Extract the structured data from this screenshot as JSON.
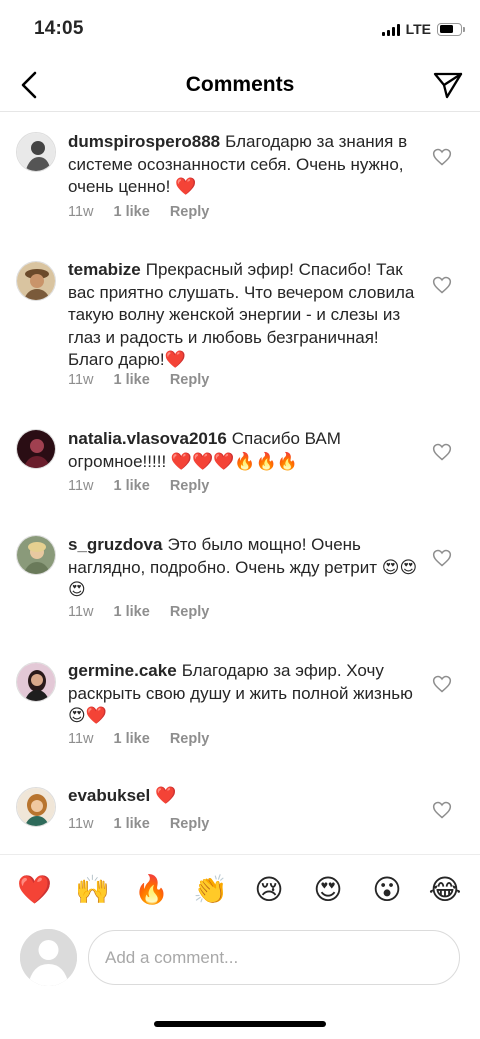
{
  "status_bar": {
    "time": "14:05",
    "network": "LTE"
  },
  "header": {
    "title": "Comments"
  },
  "comments": [
    {
      "username": "dumspirospero888",
      "text": "Благодарю за знания в системе осознанности себя. Очень нужно, очень ценно! ❤️",
      "time": "11w",
      "likes": "1 like",
      "reply": "Reply",
      "avatar_color": "#5a5a5a"
    },
    {
      "username": "temabize",
      "text": "Прекрасный эфир! Спасибо! Так вас приятно слушать. Что вечером словила такую волну женской энергии - и слезы из глаз и радость и любовь безграничная! Благо дарю!❤️",
      "time": "11w",
      "likes": "1 like",
      "reply": "Reply",
      "avatar_color": "#b08a5c"
    },
    {
      "username": "natalia.vlasova2016",
      "text": "Спасибо ВАМ огромное!!!!! ❤️❤️❤️🔥🔥🔥",
      "time": "11w",
      "likes": "1 like",
      "reply": "Reply",
      "avatar_color": "#3a1820"
    },
    {
      "username": "s_gruzdova",
      "text": "Это было мощно! Очень наглядно, подробно. Очень жду ретрит 😍😍😍",
      "time": "11w",
      "likes": "1 like",
      "reply": "Reply",
      "avatar_color": "#c9b48a"
    },
    {
      "username": "germine.cake",
      "text": "Благодарю за эфир. Хочу раскрыть свою душу и жить полной жизнью 😍❤️",
      "time": "11w",
      "likes": "1 like",
      "reply": "Reply",
      "avatar_color": "#c9a6b9"
    },
    {
      "username": "evabuksel",
      "text": "❤️",
      "time": "11w",
      "likes": "1 like",
      "reply": "Reply",
      "avatar_color": "#c99a64"
    }
  ],
  "emoji_bar": [
    "❤️",
    "🙌",
    "🔥",
    "👏",
    "😢",
    "😍",
    "😮",
    "😂"
  ],
  "input": {
    "placeholder": "Add a comment..."
  },
  "colors": {
    "text": "#262626",
    "meta": "#8e8e8e",
    "divider": "#e6e6e6",
    "heart_red": "#ed4956"
  }
}
